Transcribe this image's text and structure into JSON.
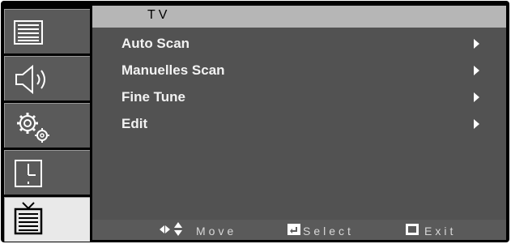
{
  "header": {
    "title": "TV"
  },
  "sidebar": {
    "items": [
      {
        "icon": "picture-icon",
        "active": false
      },
      {
        "icon": "speaker-icon",
        "active": false
      },
      {
        "icon": "gears-icon",
        "active": false
      },
      {
        "icon": "clock-icon",
        "active": false
      },
      {
        "icon": "tv-icon",
        "active": true
      }
    ]
  },
  "menu": {
    "items": [
      {
        "label": "Auto Scan"
      },
      {
        "label": "Manuelles Scan"
      },
      {
        "label": "Fine Tune"
      },
      {
        "label": "Edit"
      }
    ]
  },
  "footer": {
    "move_label": "Move",
    "select_label": "Select",
    "exit_label": "Exit"
  },
  "colors": {
    "header_bg": "#b6b6b6",
    "content_bg": "#525252",
    "sidebar_item_bg": "#5a5a5a",
    "sidebar_active_bg": "#e9e9e9",
    "text": "#f2f2f2"
  }
}
